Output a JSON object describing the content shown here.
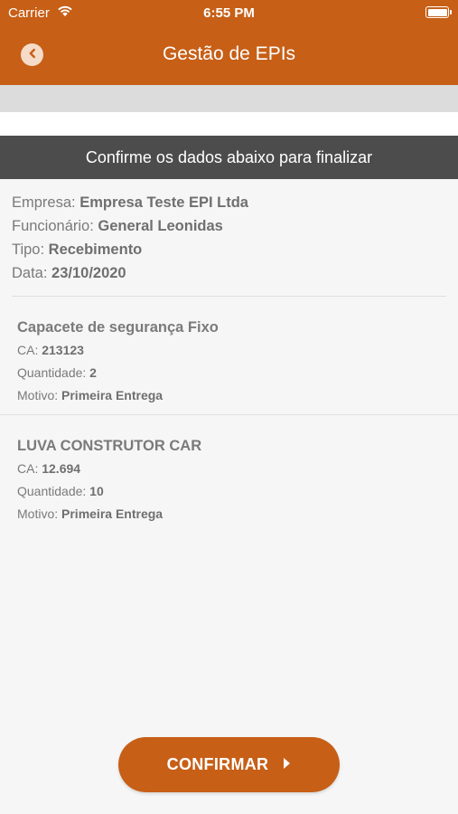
{
  "status_bar": {
    "carrier": "Carrier",
    "time": "6:55 PM",
    "wifi_icon": "wifi-icon",
    "battery_icon": "battery-icon"
  },
  "header": {
    "title": "Gestão de EPIs",
    "back_icon": "chevron-left-icon"
  },
  "banner": {
    "text": "Confirme os dados abaixo para finalizar"
  },
  "summary": [
    {
      "label": "Empresa: ",
      "value": "Empresa Teste  EPI Ltda"
    },
    {
      "label": "Funcionário: ",
      "value": "General Leonidas"
    },
    {
      "label": "Tipo: ",
      "value": "Recebimento"
    },
    {
      "label": "Data: ",
      "value": "23/10/2020"
    }
  ],
  "items": [
    {
      "title": "Capacete de segurança Fixo",
      "ca_label": "CA: ",
      "ca": "213123",
      "qty_label": "Quantidade: ",
      "qty": "2",
      "reason_label": "Motivo: ",
      "reason": "Primeira Entrega"
    },
    {
      "title": "LUVA CONSTRUTOR CAR",
      "ca_label": "CA: ",
      "ca": "12.694",
      "qty_label": "Quantidade: ",
      "qty": "10",
      "reason_label": "Motivo: ",
      "reason": "Primeira Entrega"
    }
  ],
  "confirm_button": {
    "label": "CONFIRMAR",
    "icon": "caret-right-icon"
  },
  "colors": {
    "accent": "#c75f17",
    "banner": "#4c4c4c",
    "text": "#7a7a7a",
    "background": "#f6f6f6"
  }
}
